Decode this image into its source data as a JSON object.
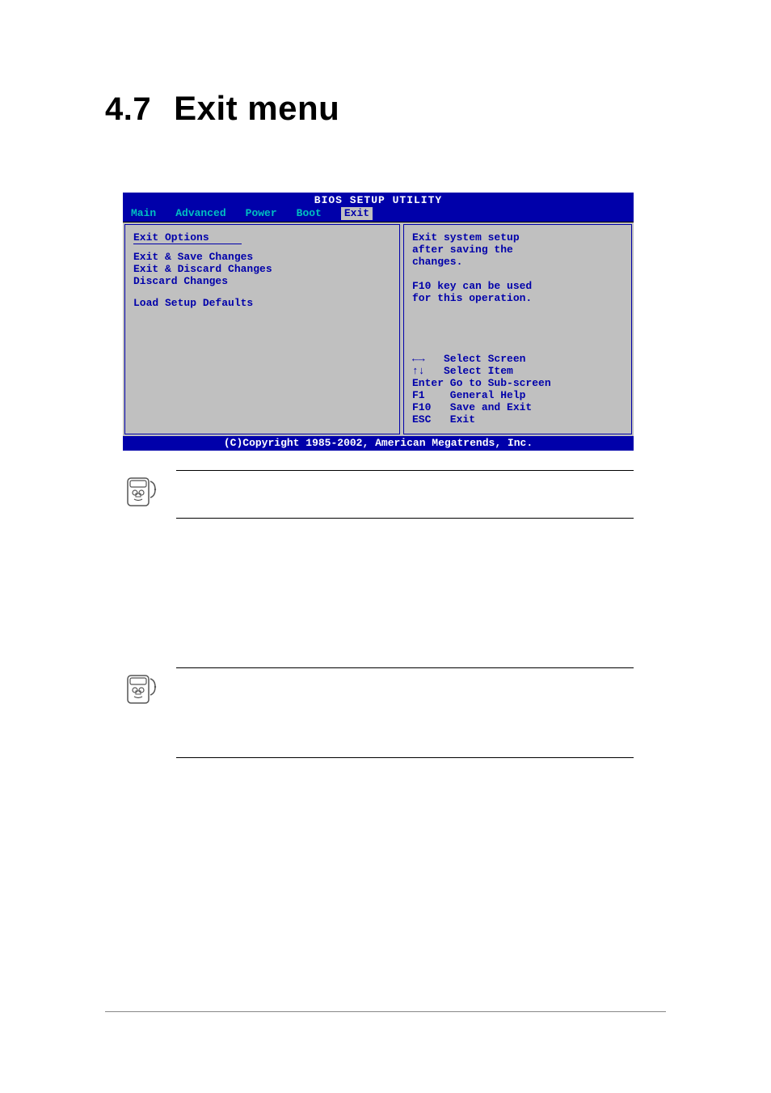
{
  "heading": {
    "number": "4.7",
    "title": "Exit menu"
  },
  "bios": {
    "title": "BIOS SETUP UTILITY",
    "tabs": {
      "t0": "Main",
      "t1": "Advanced",
      "t2": "Power",
      "t3": "Boot",
      "t4": "Exit"
    },
    "left": {
      "group_title": "Exit Options",
      "item0": "Exit & Save Changes",
      "item1": "Exit & Discard Changes",
      "item2": "Discard Changes",
      "item3": "Load Setup Defaults"
    },
    "help": "Exit system setup\nafter saving the\nchanges.\n\nF10 key can be used\nfor this operation.",
    "keys": "←→   Select Screen\n↑↓   Select Item\nEnter Go to Sub-screen\nF1    General Help\nF10   Save and Exit\nESC   Exit",
    "footer": "(C)Copyright 1985-2002, American Megatrends, Inc."
  },
  "notes": {
    "n1": "",
    "n2": ""
  }
}
